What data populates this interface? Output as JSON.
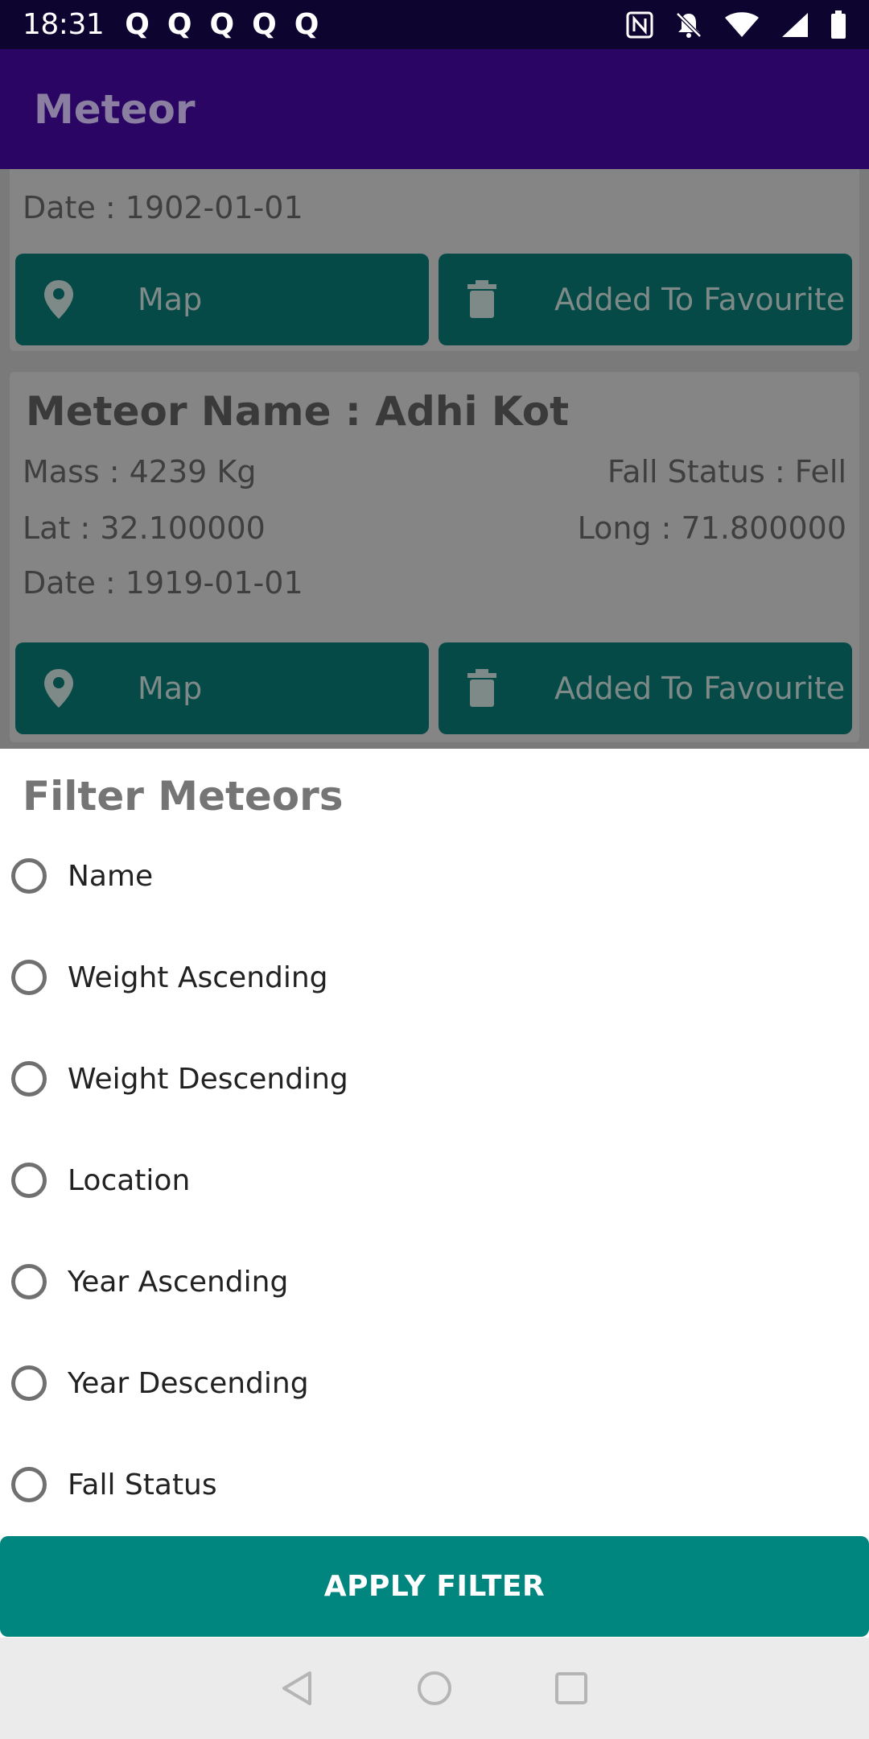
{
  "status_bar": {
    "time": "18:31",
    "notification_icons": [
      "Q",
      "Q",
      "Q",
      "Q",
      "Q"
    ]
  },
  "app_bar": {
    "title": "Meteor"
  },
  "cards": [
    {
      "date": "Date : 1902-01-01",
      "map_label": "Map",
      "favourite_label": "Added To Favourite"
    },
    {
      "name": "Meteor Name : Adhi Kot",
      "mass": "Mass : 4239 Kg",
      "fall_status": "Fall Status : Fell",
      "lat": "Lat : 32.100000",
      "long": "Long : 71.800000",
      "date": "Date : 1919-01-01",
      "map_label": "Map",
      "favourite_label": "Added To Favourite"
    }
  ],
  "filter_sheet": {
    "title": "Filter Meteors",
    "options": [
      "Name",
      "Weight Ascending",
      "Weight Descending",
      "Location",
      "Year Ascending",
      "Year Descending",
      "Fall Status"
    ],
    "apply_label": "APPLY FILTER"
  },
  "colors": {
    "app_bar": "#2b0563",
    "card_button": "#054a46",
    "apply_button": "#00857f"
  }
}
